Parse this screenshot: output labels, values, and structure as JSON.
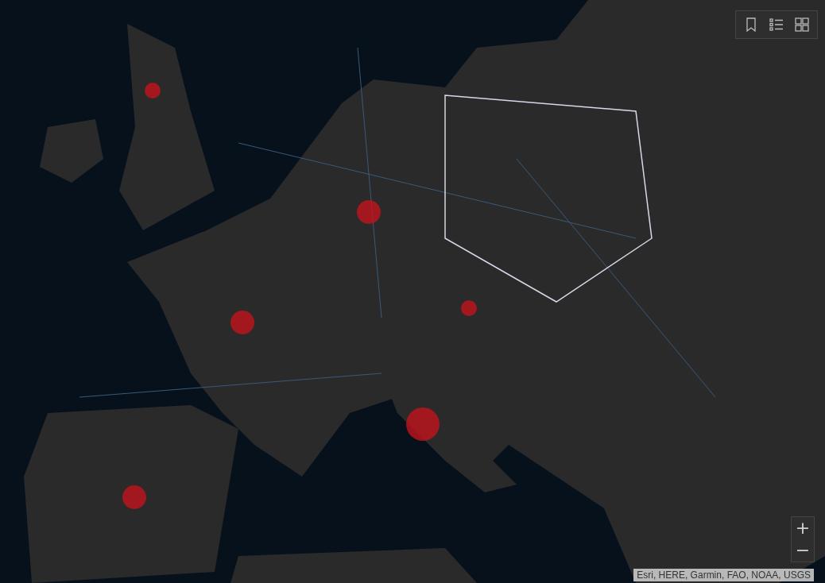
{
  "toolbar": [
    {
      "kind": "bookmark"
    },
    {
      "kind": "list"
    },
    {
      "kind": "gallery"
    }
  ],
  "zoom": {
    "in": "+",
    "out": "−"
  },
  "attribution": "Esri, HERE, Garmin, FAO, NOAA, USGS"
}
